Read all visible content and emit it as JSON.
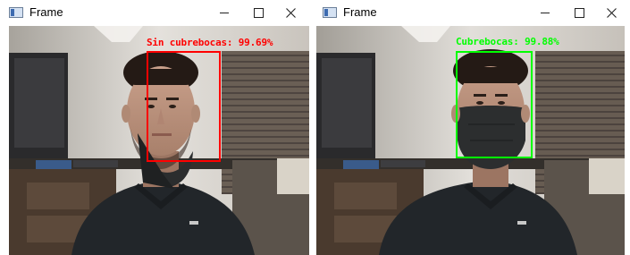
{
  "windows": [
    {
      "title": "Frame",
      "detection": {
        "label": "Sin cubrebocas: 99.69%",
        "color": "#ff0000"
      }
    },
    {
      "title": "Frame",
      "detection": {
        "label": "Cubrebocas: 99.88%",
        "color": "#00ff00"
      }
    }
  ],
  "icons": [
    "app-window-icon",
    "minimize-icon",
    "maximize-icon",
    "close-icon"
  ]
}
